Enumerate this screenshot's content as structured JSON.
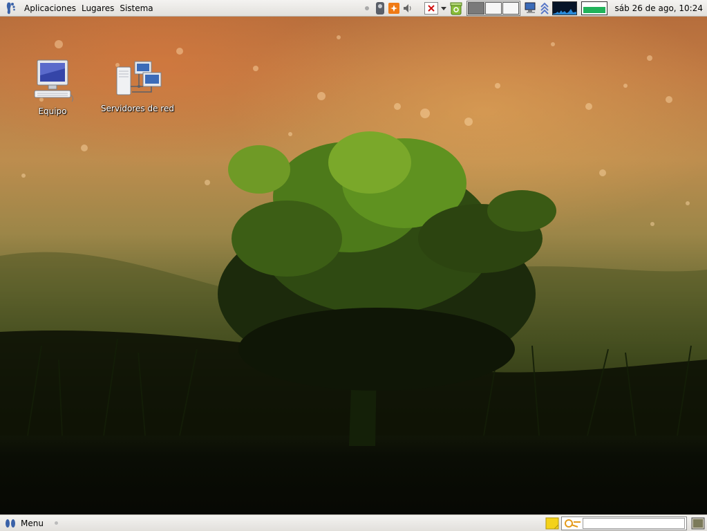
{
  "top_panel": {
    "menus": {
      "applications": "Aplicaciones",
      "places": "Lugares",
      "system": "Sistema"
    },
    "clock": "sáb 26 de ago, 10:24",
    "icons": {
      "logo": "gnome-foot-icon",
      "dot": "panel-separator-dot-icon",
      "volume": "volume-icon",
      "network": "network-manager-icon",
      "speaker": "speaker-icon",
      "close": "close-window-icon",
      "dropdown": "window-list-dropdown-icon",
      "recycle": "trash-icon",
      "computer": "network-monitor-icon",
      "updates": "update-arrows-icon"
    },
    "workspaces": [
      "1",
      "2",
      "3"
    ],
    "active_workspace": 0,
    "memory_level": 0.55
  },
  "desktop": {
    "icons": [
      {
        "label": "Equipo",
        "icon": "computer-icon"
      },
      {
        "label": "Servidores de red",
        "icon": "network-servers-icon"
      }
    ]
  },
  "bottom_panel": {
    "menu_label": "Menu",
    "search_value": "",
    "icons": {
      "menu": "footprints-icon",
      "notes": "sticky-notes-icon",
      "search": "deskbar-search-icon",
      "show_desktop": "show-desktop-icon"
    }
  },
  "colors": {
    "panel": "#ecebe8",
    "accent": "#21b35a",
    "graph_bg": "#071428"
  }
}
